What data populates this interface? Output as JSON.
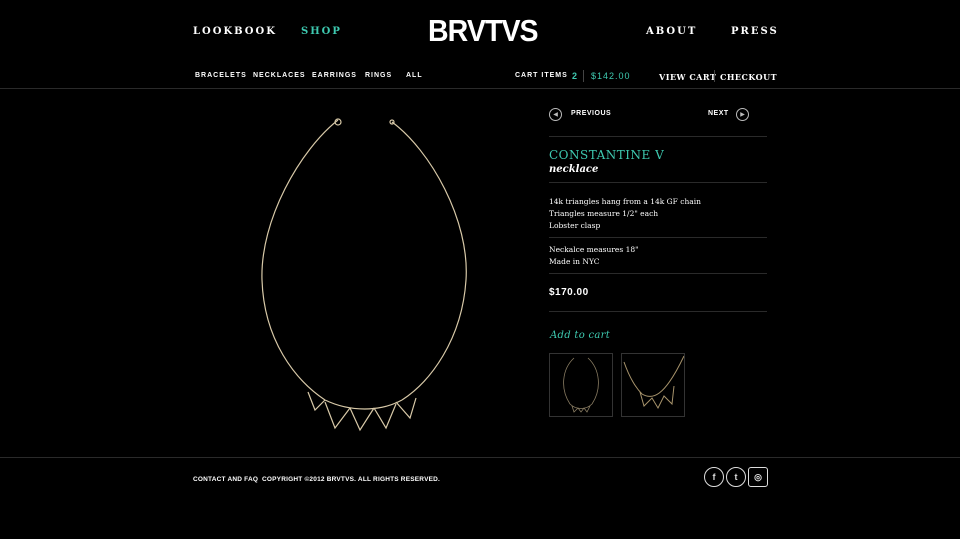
{
  "header": {
    "logo": "BRVTVS",
    "nav_left": [
      "LOOKBOOK",
      "SHOP"
    ],
    "nav_right": [
      "ABOUT",
      "PRESS"
    ]
  },
  "subnav": [
    "BRACELETS",
    "NECKLACES",
    "EARRINGS",
    "RINGS",
    "ALL"
  ],
  "cart": {
    "label": "CART ITEMS",
    "count": "2",
    "total": "$142.00",
    "view_cart": "VIEW CART",
    "checkout": "CHECKOUT"
  },
  "pager": {
    "previous": "PREVIOUS",
    "next": "NEXT"
  },
  "product": {
    "name": "CONSTANTINE V",
    "type": "necklace",
    "desc1": [
      "14k triangles hang from a 14k GF chain",
      "Triangles measure 1/2\" each",
      "Lobster clasp"
    ],
    "desc2": [
      "Neckalce measures 18\"",
      "Made in NYC"
    ],
    "price": "$170.00",
    "add_to_cart": "Add to cart"
  },
  "footer": {
    "contact": "CONTACT AND FAQ",
    "copyright": "COPYRIGHT ©2012 BRVTVS. ALL RIGHTS RESERVED."
  },
  "colors": {
    "accent": "#3ec9b0",
    "background": "#000000"
  },
  "social_icons": [
    "facebook-icon",
    "twitter-icon",
    "instagram-icon"
  ]
}
